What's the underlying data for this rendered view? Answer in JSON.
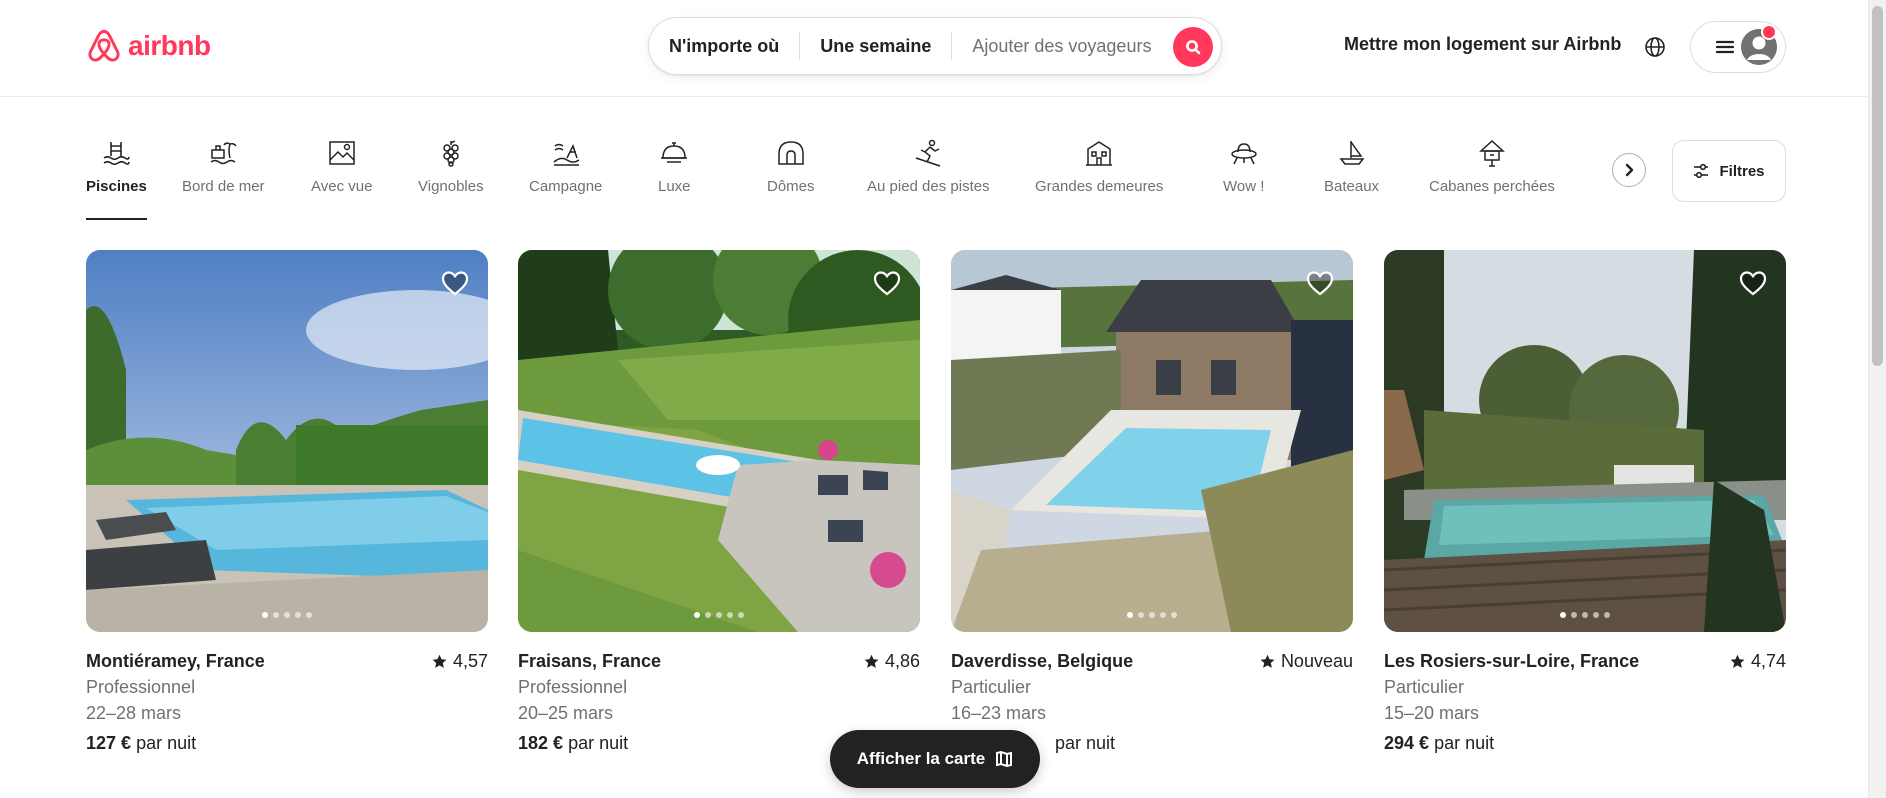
{
  "header": {
    "logo_text": "airbnb",
    "search": {
      "where": "N'importe où",
      "when": "Une semaine",
      "who": "Ajouter des voyageurs"
    },
    "host_link": "Mettre mon logement sur Airbnb"
  },
  "categories": [
    {
      "label": "Piscines",
      "icon": "pool-icon",
      "active": true
    },
    {
      "label": "Bord de mer",
      "icon": "beachfront-icon"
    },
    {
      "label": "Avec vue",
      "icon": "view-icon"
    },
    {
      "label": "Vignobles",
      "icon": "vineyard-icon"
    },
    {
      "label": "Campagne",
      "icon": "countryside-icon"
    },
    {
      "label": "Luxe",
      "icon": "luxe-icon"
    },
    {
      "label": "Dômes",
      "icon": "dome-icon"
    },
    {
      "label": "Au pied des pistes",
      "icon": "ski-icon"
    },
    {
      "label": "Grandes demeures",
      "icon": "mansion-icon"
    },
    {
      "label": "Wow !",
      "icon": "ufo-icon"
    },
    {
      "label": "Bateaux",
      "icon": "boat-icon"
    },
    {
      "label": "Cabanes perchées",
      "icon": "treehouse-icon"
    }
  ],
  "filters_label": "Filtres",
  "listings": [
    {
      "location": "Montiéramey, France",
      "rating": "4,57",
      "host_type": "Professionnel",
      "dates": "22–28 mars",
      "price": "127 €",
      "price_suffix": "par nuit"
    },
    {
      "location": "Fraisans, France",
      "rating": "4,86",
      "host_type": "Professionnel",
      "dates": "20–25 mars",
      "price": "182 €",
      "price_suffix": "par nuit"
    },
    {
      "location": "Daverdisse, Belgique",
      "rating": "Nouveau",
      "host_type": "Particulier",
      "dates": "16–23 mars",
      "price": "",
      "price_suffix": "par nuit"
    },
    {
      "location": "Les Rosiers-sur-Loire, France",
      "rating": "4,74",
      "host_type": "Particulier",
      "dates": "15–20 mars",
      "price": "294 €",
      "price_suffix": "par nuit"
    }
  ],
  "map_button_label": "Afficher la carte",
  "colors": {
    "brand": "#FF385C",
    "text": "#222222",
    "muted": "#717171"
  }
}
